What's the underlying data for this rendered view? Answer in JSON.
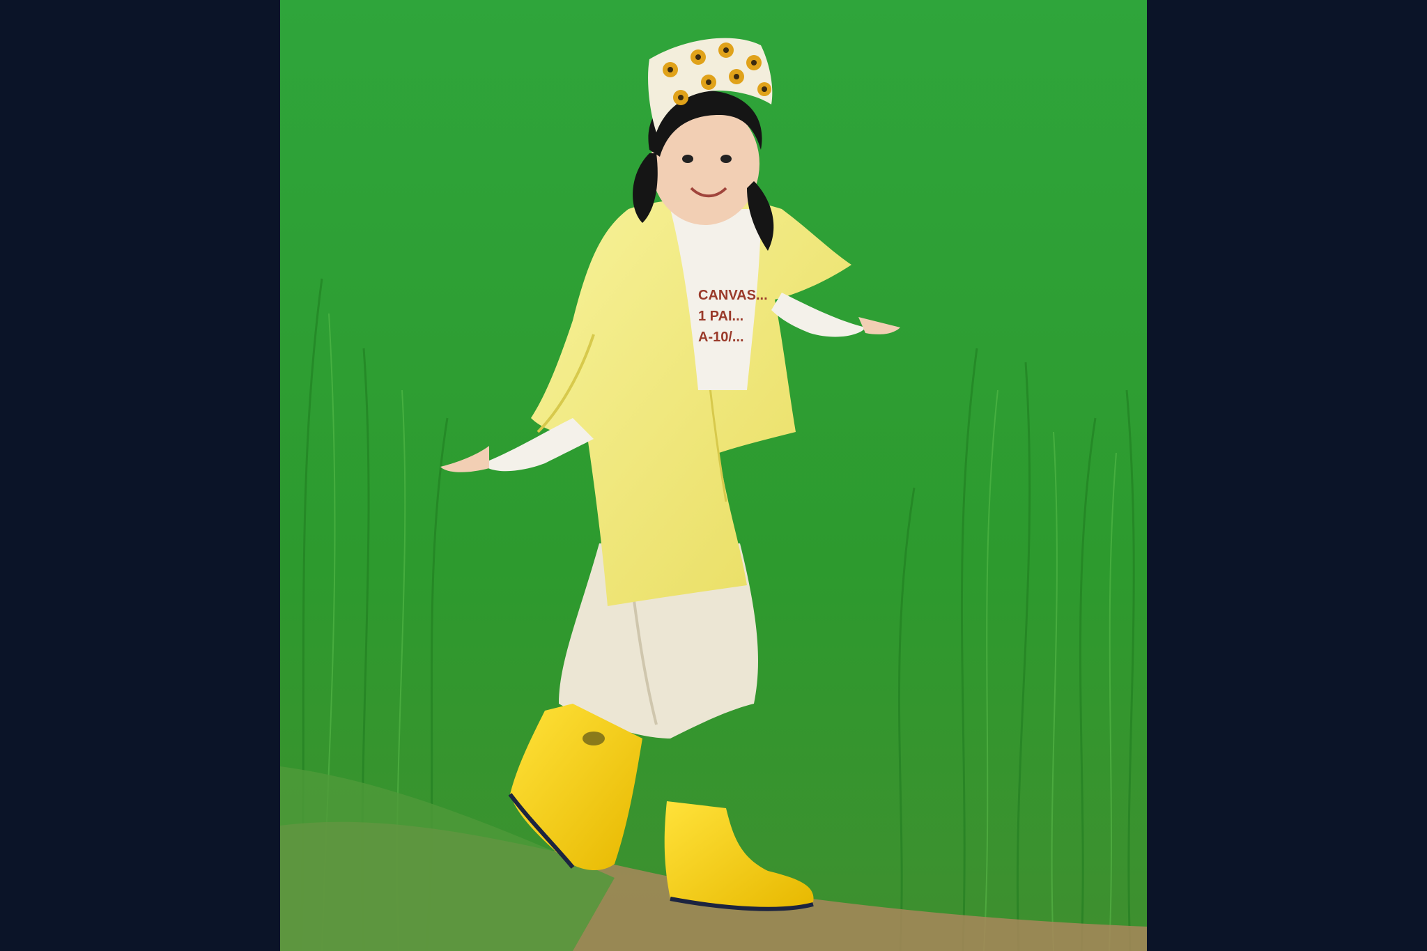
{
  "viewer": {
    "background_color": "#0b1428"
  },
  "photo": {
    "subject": "child in yellow shirt and yellow rain boots walking along a rice field path",
    "shirt_print_lines": [
      "CANVAS...",
      "1 PAI...",
      "A-10/..."
    ],
    "colors": {
      "grass": "#2f9a2c",
      "grass_dark": "#1f7a1f",
      "shirt": "#f2ec7a",
      "boots": "#f4d10a",
      "pants": "#ece6d4",
      "headscarf": "#f3eedc",
      "sunflower": "#e0a21a",
      "soil": "#a8875a"
    }
  }
}
